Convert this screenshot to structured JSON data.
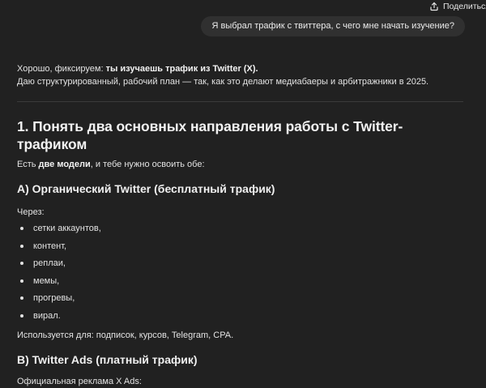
{
  "header": {
    "share_label": "Поделиться",
    "share_icon": "share-icon"
  },
  "user_message": "Я выбрал трафик с твиттера, с чего мне начать изучение?",
  "answer": {
    "intro_prefix": "Хорошо, фиксируем: ",
    "intro_bold": "ты изучаешь трафик из Twitter (X).",
    "intro_line2": "Даю структурированный, рабочий план — так, как это делают медиабаеры и арбитражники в 2025.",
    "section1": {
      "title": "1. Понять два основных направления работы с Twitter-трафиком",
      "lead_prefix": "Есть ",
      "lead_bold": "две модели",
      "lead_suffix": ", и тебе нужно освоить обе:"
    },
    "subsection_a": {
      "title": "A) Органический Twitter (бесплатный трафик)",
      "through_label": "Через:",
      "items": [
        "сетки аккаунтов,",
        "контент,",
        "реплаи,",
        "мемы,",
        "прогревы,",
        "вирал."
      ],
      "usage": "Используется для: подписок, курсов, Telegram, CPA."
    },
    "subsection_b": {
      "title": "B) Twitter Ads (платный трафик)",
      "line": "Официальная реклама X Ads:"
    }
  },
  "colors": {
    "background": "#212121",
    "bubble": "#303030",
    "text": "#ececec",
    "divider": "#3b3b3b"
  }
}
